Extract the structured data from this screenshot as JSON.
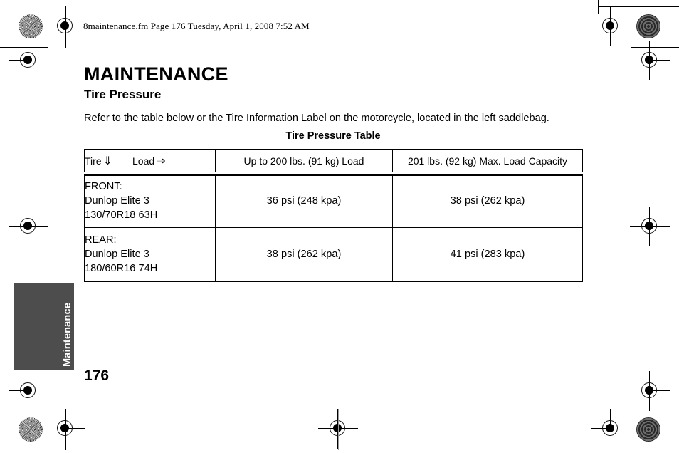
{
  "document": {
    "running_header": "8maintenance.fm  Page 176  Tuesday, April 1, 2008  7:52 AM",
    "page_title": "MAINTENANCE",
    "section_title": "Tire Pressure",
    "body_paragraph": "Refer to the table below or the Tire Information Label on the motorcycle, located in the left saddlebag.",
    "table_caption": "Tire Pressure Table",
    "folio": "176",
    "side_tab_label": "Maintenance",
    "side_tab_color": "#4d4d4d"
  },
  "table": {
    "header": {
      "tire_label": "Tire",
      "tire_arrow": "⇓",
      "load_label": "Load",
      "load_arrow": "⇒",
      "columns": [
        "Up to 200 lbs. (91 kg) Load",
        "201 lbs. (92 kg) Max. Load Capacity"
      ]
    },
    "rows": [
      {
        "position": "FRONT:",
        "tire_brand": "Dunlop Elite 3",
        "tire_size": "130/70R18 63H",
        "pressure_standard": "36 psi (248 kpa)",
        "pressure_max": "38 psi (262 kpa)"
      },
      {
        "position": "REAR:",
        "tire_brand": "Dunlop Elite 3",
        "tire_size": "180/60R16 74H",
        "pressure_standard": "38 psi (262 kpa)",
        "pressure_max": "41 psi (283 kpa)"
      }
    ]
  }
}
